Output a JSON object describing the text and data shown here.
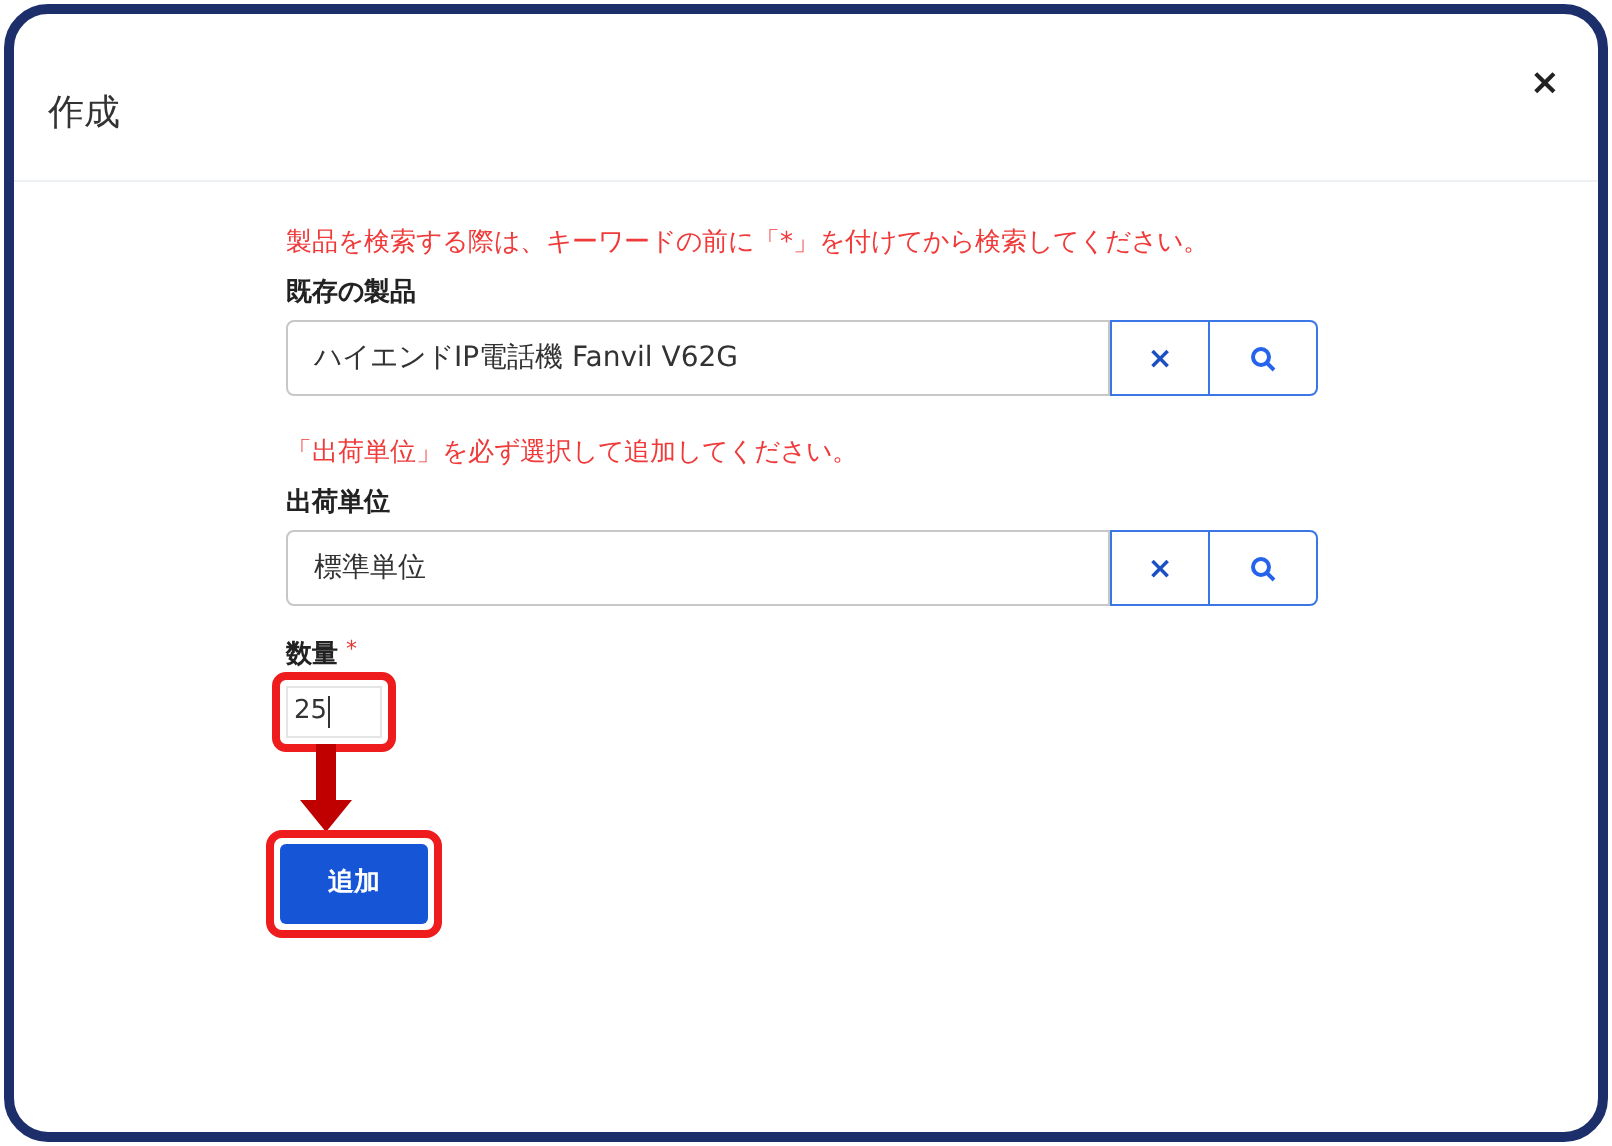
{
  "dialog": {
    "title": "作成",
    "close": "×"
  },
  "fields": [
    {
      "kind": "lookup",
      "hint": "製品を検索する際は、キーワードの前に「*」を付けてから検索してください。",
      "label": "既存の製品",
      "value": "ハイエンドIP電話機 Fanvil V62G",
      "clear": "×"
    },
    {
      "kind": "lookup",
      "hint": "「出荷単位」を必ず選択して追加してください。",
      "label": "出荷単位",
      "value": "標準単位",
      "clear": "×"
    }
  ],
  "quantity": {
    "label": "数量",
    "required_mark": "*",
    "value": "25"
  },
  "add_button": "追加"
}
